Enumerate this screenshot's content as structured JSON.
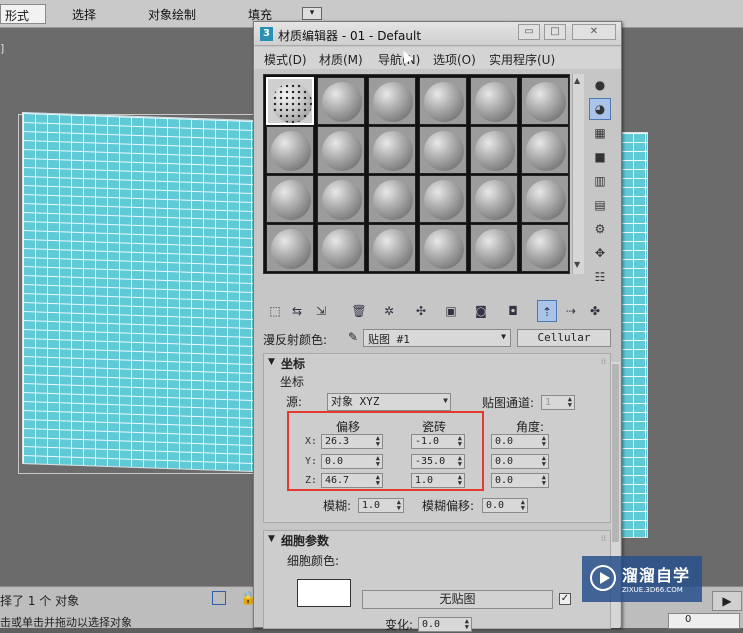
{
  "ribbon": {
    "tabs": [
      "形式",
      "选择",
      "对象绘制",
      "填充"
    ],
    "dropdown_icon": "▾"
  },
  "viewport": {
    "label": "]"
  },
  "status": {
    "line1": "择了 1 个 对象",
    "line2": "击或单击并拖动以选择对象",
    "play_icon": "▶",
    "frame_value": "0"
  },
  "watermark": {
    "title": "溜溜自学",
    "url": "ZIXUE.3D66.COM"
  },
  "editor": {
    "app_icon_text": "3",
    "title": "材质编辑器 - 01 - Default",
    "window_buttons": [
      "▭",
      "□",
      "✕"
    ],
    "menu": [
      "模式(D)",
      "材质(M)",
      "导航(N)",
      "选项(O)",
      "实用程序(U)"
    ],
    "map_row": {
      "label": "漫反射颜色:",
      "map_name": "贴图 #1",
      "map_type": "Cellular"
    },
    "coordinates": {
      "rollout_sign": "▼",
      "rollout_title": "坐标",
      "section_label": "坐标",
      "source_label": "源:",
      "source_value": "对象 XYZ",
      "channel_label": "贴图通道:",
      "channel_value": "1",
      "col_offset": "偏移",
      "col_tiling": "瓷砖",
      "col_angle": "角度:",
      "rows": [
        {
          "axis": "X:",
          "offset": "26.3",
          "tiling": "-1.0",
          "angle": "0.0"
        },
        {
          "axis": "Y:",
          "offset": "0.0",
          "tiling": "-35.0",
          "angle": "0.0"
        },
        {
          "axis": "Z:",
          "offset": "46.7",
          "tiling": "1.0",
          "angle": "0.0"
        }
      ],
      "blur_label": "模糊:",
      "blur_value": "1.0",
      "blur_offset_label": "模糊偏移:",
      "blur_offset_value": "0.0"
    },
    "cell_params": {
      "rollout_sign": "▼",
      "rollout_title": "细胞参数",
      "color_label": "细胞颜色:",
      "no_map": "无贴图",
      "variation_label": "变化:",
      "variation_value": "0.0"
    }
  }
}
